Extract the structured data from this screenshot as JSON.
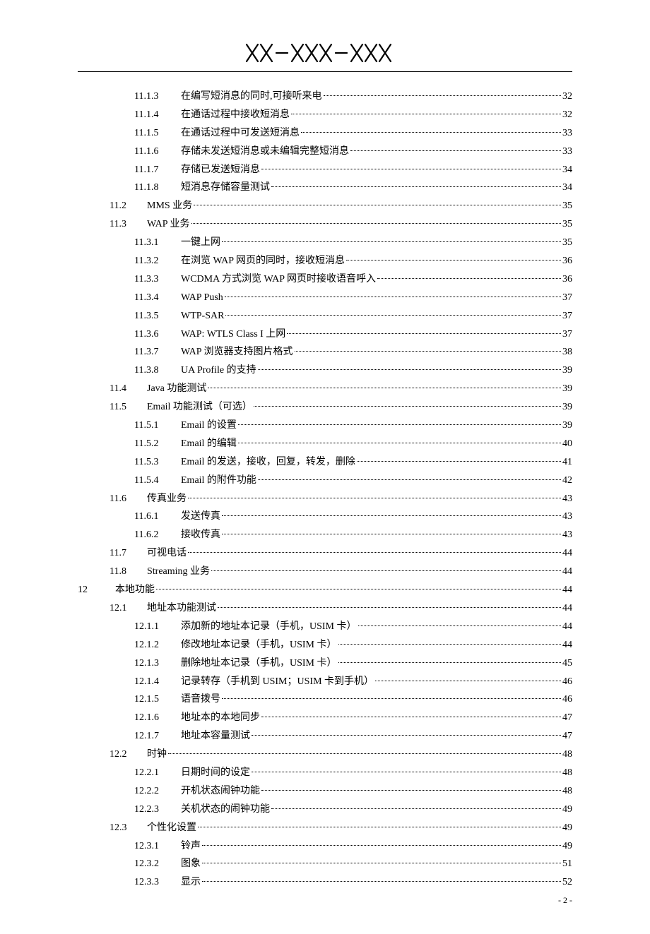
{
  "header": {
    "text_alt": "XX-XXX-XXX"
  },
  "toc": [
    {
      "level": 3,
      "num": "11.1.3",
      "title": "在编写短消息的同时,可接听来电",
      "page": "32"
    },
    {
      "level": 3,
      "num": "11.1.4",
      "title": "在通话过程中接收短消息",
      "page": "32"
    },
    {
      "level": 3,
      "num": "11.1.5",
      "title": "在通话过程中可发送短消息",
      "page": "33"
    },
    {
      "level": 3,
      "num": "11.1.6",
      "title": "存储未发送短消息或未编辑完整短消息",
      "page": "33"
    },
    {
      "level": 3,
      "num": "11.1.7",
      "title": "存储已发送短消息",
      "page": "34"
    },
    {
      "level": 3,
      "num": "11.1.8",
      "title": "短消息存储容量测试",
      "page": "34"
    },
    {
      "level": 2,
      "num": "11.2",
      "title": "MMS 业务",
      "page": "35"
    },
    {
      "level": 2,
      "num": "11.3",
      "title": "WAP 业务",
      "page": "35"
    },
    {
      "level": 3,
      "num": "11.3.1",
      "title": "一键上网",
      "page": "35"
    },
    {
      "level": 3,
      "num": "11.3.2",
      "title": "在浏览 WAP 网页的同时，接收短消息",
      "page": "36"
    },
    {
      "level": 3,
      "num": "11.3.3",
      "title": "WCDMA 方式浏览 WAP 网页时接收语音呼入",
      "page": "36"
    },
    {
      "level": 3,
      "num": "11.3.4",
      "title": "WAP Push",
      "page": "37"
    },
    {
      "level": 3,
      "num": "11.3.5",
      "title": "WTP-SAR",
      "page": "37"
    },
    {
      "level": 3,
      "num": "11.3.6",
      "title": "WAP: WTLS Class I  上网",
      "page": "37"
    },
    {
      "level": 3,
      "num": "11.3.7",
      "title": "WAP 浏览器支持图片格式",
      "page": "38"
    },
    {
      "level": 3,
      "num": "11.3.8",
      "title": "UA Profile 的支持",
      "page": "39"
    },
    {
      "level": 2,
      "num": "11.4",
      "title": "Java  功能测试",
      "page": "39"
    },
    {
      "level": 2,
      "num": "11.5",
      "title": "Email 功能测试（可选）",
      "page": "39"
    },
    {
      "level": 3,
      "num": "11.5.1",
      "title": "Email 的设置",
      "page": "39"
    },
    {
      "level": 3,
      "num": "11.5.2",
      "title": "Email 的编辑",
      "page": "40"
    },
    {
      "level": 3,
      "num": "11.5.3",
      "title": "Email 的发送，接收，回复，转发，删除",
      "page": "41"
    },
    {
      "level": 3,
      "num": "11.5.4",
      "title": "Email 的附件功能",
      "page": "42"
    },
    {
      "level": 2,
      "num": "11.6",
      "title": "传真业务",
      "page": "43"
    },
    {
      "level": 3,
      "num": "11.6.1",
      "title": "发送传真",
      "page": "43"
    },
    {
      "level": 3,
      "num": "11.6.2",
      "title": "接收传真",
      "page": "43"
    },
    {
      "level": 2,
      "num": "11.7",
      "title": "可视电话",
      "page": "44"
    },
    {
      "level": 2,
      "num": "11.8",
      "title": "Streaming 业务",
      "page": "44"
    },
    {
      "level": 1,
      "num": "12",
      "title": "本地功能",
      "page": "44"
    },
    {
      "level": 2,
      "num": "12.1",
      "title": "地址本功能测试",
      "page": "44"
    },
    {
      "level": 3,
      "num": "12.1.1",
      "title": "添加新的地址本记录（手机，USIM 卡）",
      "page": "44"
    },
    {
      "level": 3,
      "num": "12.1.2",
      "title": "修改地址本记录（手机，USIM 卡）",
      "page": "44"
    },
    {
      "level": 3,
      "num": "12.1.3",
      "title": "删除地址本记录（手机，USIM 卡）",
      "page": "45"
    },
    {
      "level": 3,
      "num": "12.1.4",
      "title": "记录转存（手机到 USIM；USIM 卡到手机）",
      "page": "46"
    },
    {
      "level": 3,
      "num": "12.1.5",
      "title": "语音拨号",
      "page": "46"
    },
    {
      "level": 3,
      "num": "12.1.6",
      "title": "地址本的本地同步",
      "page": "47"
    },
    {
      "level": 3,
      "num": "12.1.7",
      "title": "地址本容量测试",
      "page": "47"
    },
    {
      "level": 2,
      "num": "12.2",
      "title": "时钟",
      "page": "48"
    },
    {
      "level": 3,
      "num": "12.2.1",
      "title": "日期时间的设定",
      "page": "48"
    },
    {
      "level": 3,
      "num": "12.2.2",
      "title": "开机状态闹钟功能",
      "page": "48"
    },
    {
      "level": 3,
      "num": "12.2.3",
      "title": "关机状态的闹钟功能",
      "page": "49"
    },
    {
      "level": 2,
      "num": "12.3",
      "title": "个性化设置",
      "page": "49"
    },
    {
      "level": 3,
      "num": "12.3.1",
      "title": "铃声",
      "page": "49"
    },
    {
      "level": 3,
      "num": "12.3.2",
      "title": "图象",
      "page": "51"
    },
    {
      "level": 3,
      "num": "12.3.3",
      "title": "显示",
      "page": "52"
    }
  ],
  "page_number": "- 2 -"
}
